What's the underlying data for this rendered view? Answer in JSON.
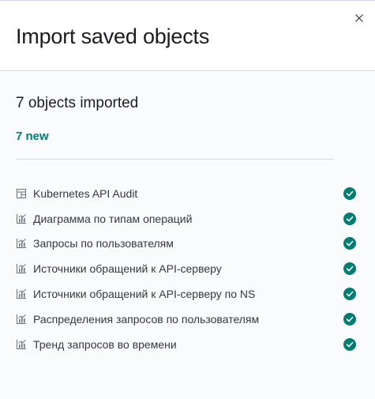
{
  "flyout": {
    "title": "Import saved objects",
    "summary": "7 objects imported",
    "new_count": "7 new"
  },
  "objects": [
    {
      "icon": "dashboard-icon",
      "label": "Kubernetes API Audit"
    },
    {
      "icon": "visualization-icon",
      "label": "Диаграмма по типам операций"
    },
    {
      "icon": "visualization-icon",
      "label": "Запросы по пользователям"
    },
    {
      "icon": "visualization-icon",
      "label": "Источники обращений к API-серверу"
    },
    {
      "icon": "visualization-icon",
      "label": "Источники обращений к API-серверу по NS"
    },
    {
      "icon": "visualization-icon",
      "label": "Распределения запросов по пользователям"
    },
    {
      "icon": "visualization-icon",
      "label": "Тренд запросов во времени"
    }
  ],
  "colors": {
    "success": "#017d73",
    "border": "#d3dae6",
    "text": "#343741"
  }
}
